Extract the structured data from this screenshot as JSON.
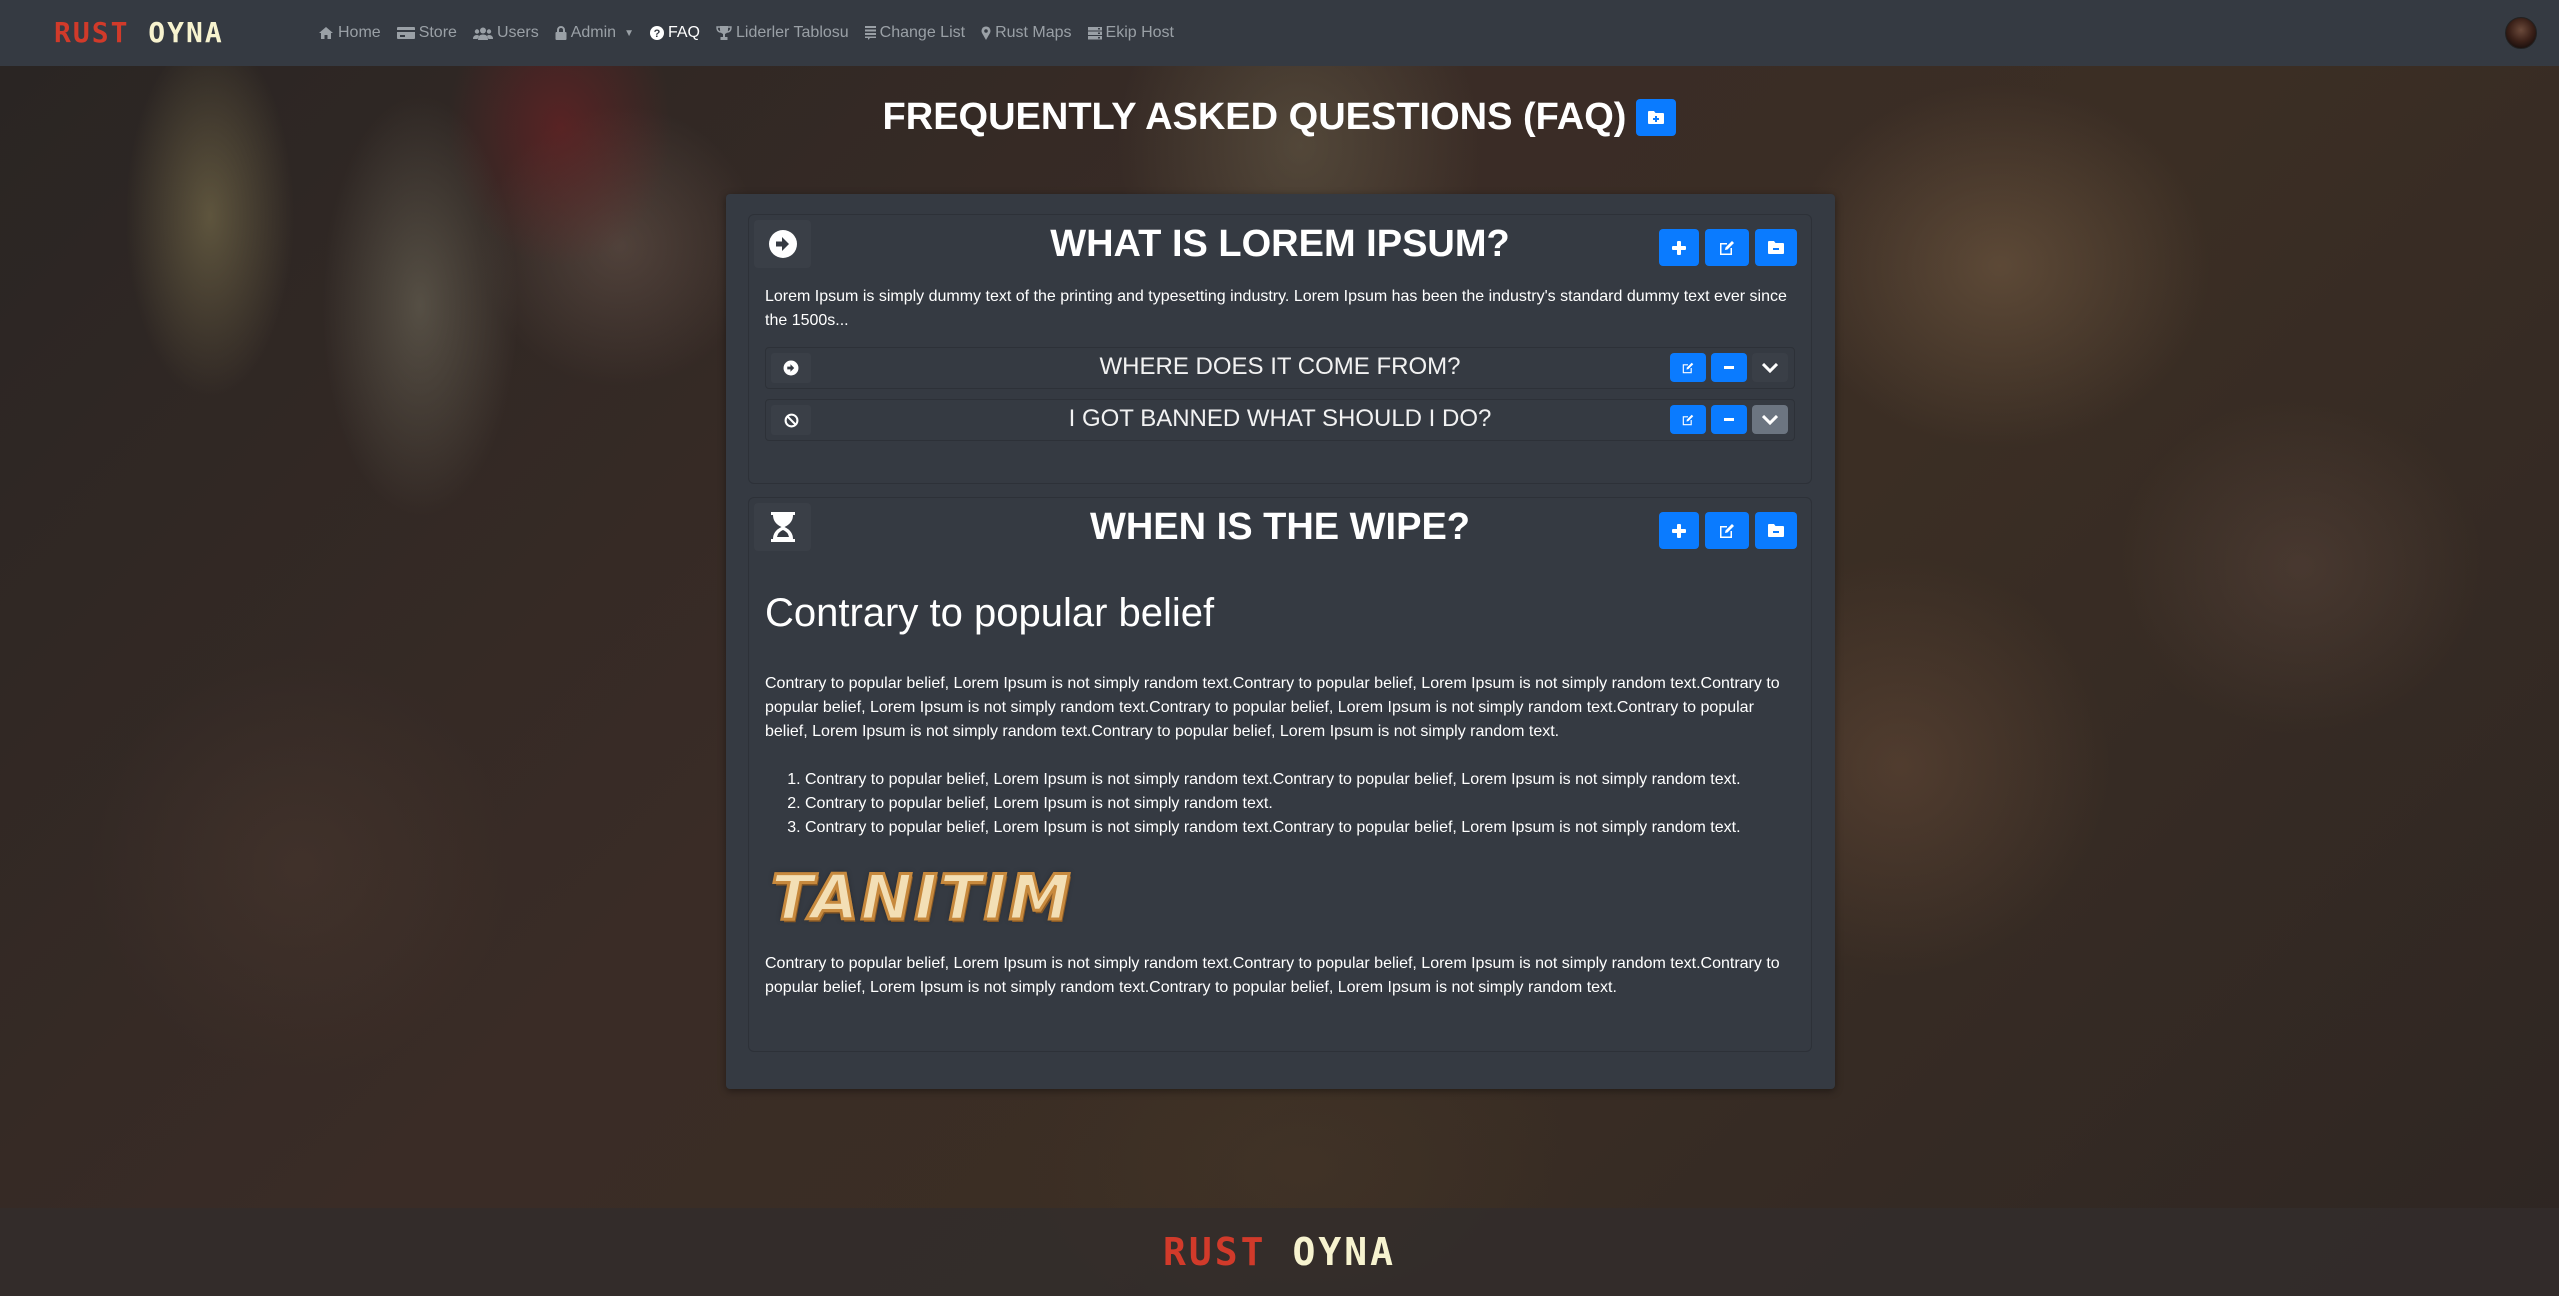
{
  "brand": {
    "part1": "RUST",
    "part2": "OYNA"
  },
  "nav": {
    "items": [
      {
        "label": "Home",
        "icon": "home-icon",
        "glyph": "⌂"
      },
      {
        "label": "Store",
        "icon": "credit-card-icon",
        "glyph": "▬"
      },
      {
        "label": "Users",
        "icon": "users-icon",
        "glyph": "👥"
      },
      {
        "label": "Admin",
        "icon": "lock-icon",
        "glyph": "🔒"
      },
      {
        "label": "FAQ",
        "icon": "question-circle-icon",
        "glyph": "?"
      },
      {
        "label": "Liderler Tablosu",
        "icon": "trophy-icon",
        "glyph": "🏆"
      },
      {
        "label": "Change List",
        "icon": "list-icon",
        "glyph": "≡"
      },
      {
        "label": "Rust Maps",
        "icon": "map-marker-icon",
        "glyph": "⚲"
      },
      {
        "label": "Ekip Host",
        "icon": "server-icon",
        "glyph": "☰"
      }
    ],
    "active": "FAQ"
  },
  "page": {
    "title": "FREQUENTLY ASKED QUESTIONS (FAQ)",
    "add_category_icon": "folder-plus-icon"
  },
  "categories": [
    {
      "title": "WHAT IS LOREM IPSUM?",
      "icon": "arrow-circle-right-icon",
      "intro": "Lorem Ipsum is simply dummy text of the printing and typesetting industry. Lorem Ipsum has been the industry's standard dummy text ever since the 1500s...",
      "actions": [
        "plus-icon",
        "edit-icon",
        "folder-minus-icon"
      ],
      "questions": [
        {
          "title": "WHERE DOES IT COME FROM?",
          "icon": "arrow-circle-right-icon",
          "expanded": false
        },
        {
          "title": "I GOT BANNED WHAT SHOULD I DO?",
          "icon": "ban-icon",
          "expanded": true
        }
      ]
    },
    {
      "title": "WHEN IS THE WIPE?",
      "icon": "hourglass-icon",
      "actions": [
        "plus-icon",
        "edit-icon",
        "folder-minus-icon"
      ],
      "heading": "Contrary to popular belief",
      "paragraph1": "Contrary to popular belief, Lorem Ipsum is not simply random text.Contrary to popular belief, Lorem Ipsum is not simply random text.Contrary to popular belief, Lorem Ipsum is not simply random text.Contrary to popular belief, Lorem Ipsum is not simply random text.Contrary to popular belief, Lorem Ipsum is not simply random text.Contrary to popular belief, Lorem Ipsum is not simply random text.",
      "list": [
        "Contrary to popular belief, Lorem Ipsum is not simply random text.Contrary to popular belief, Lorem Ipsum is not simply random text.",
        "Contrary to popular belief, Lorem Ipsum is not simply random text.",
        "Contrary to popular belief, Lorem Ipsum is not simply random text.Contrary to popular belief, Lorem Ipsum is not simply random text."
      ],
      "image_text": "TANITIM",
      "paragraph2": "Contrary to popular belief, Lorem Ipsum is not simply random text.Contrary to popular belief, Lorem Ipsum is not simply random text.Contrary to popular belief, Lorem Ipsum is not simply random text.Contrary to popular belief, Lorem Ipsum is not simply random text."
    }
  ],
  "footer": {
    "part1": "RUST",
    "part2": "OYNA"
  },
  "colors": {
    "accent": "#0a7bff",
    "navbar": "#353a42",
    "brand_red": "#d13a2a",
    "brand_cream": "#f7f3cf"
  }
}
